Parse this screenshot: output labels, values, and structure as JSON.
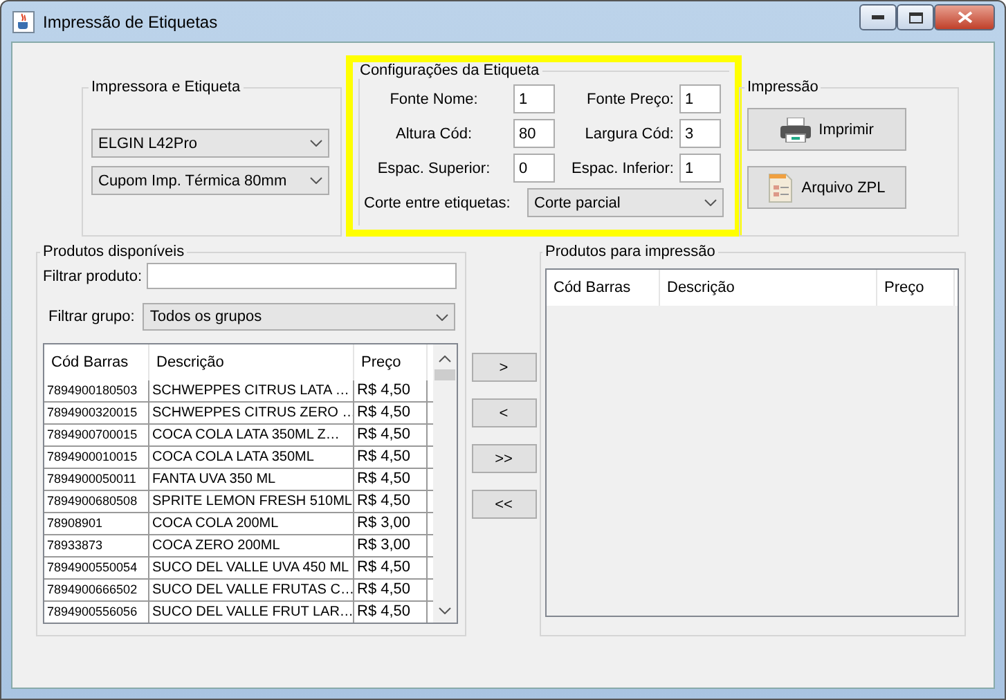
{
  "window": {
    "title": "Impressão de Etiquetas"
  },
  "printer_group": {
    "title": "Impressora e Etiqueta",
    "printer": "ELGIN L42Pro",
    "label_type": "Cupom Imp. Térmica 80mm"
  },
  "config_group": {
    "title": "Configurações da Etiqueta",
    "highlighted": true,
    "fields": [
      {
        "label": "Fonte Nome:",
        "value": "1"
      },
      {
        "label": "Fonte Preço:",
        "value": "1"
      },
      {
        "label": "Altura Cód:",
        "value": "80"
      },
      {
        "label": "Largura Cód:",
        "value": "3"
      },
      {
        "label": "Espac. Superior:",
        "value": "0"
      },
      {
        "label": "Espac. Inferior:",
        "value": "1"
      }
    ],
    "cut_label": "Corte entre etiquetas:",
    "cut_value": "Corte parcial"
  },
  "print_group": {
    "title": "Impressão",
    "buttons": [
      {
        "label": "Imprimir",
        "kind": "printer"
      },
      {
        "label": "Arquivo ZPL",
        "kind": "file"
      }
    ]
  },
  "available": {
    "title": "Produtos disponíveis",
    "filter_label": "Filtrar produto:",
    "group_label": "Filtrar grupo:",
    "group_value": "Todos os grupos",
    "columns": [
      "Cód Barras",
      "Descrição",
      "Preço"
    ],
    "rows": [
      [
        "7894900180503",
        "SCHWEPPES CITRUS LATA …",
        "R$ 4,50"
      ],
      [
        "7894900320015",
        "SCHWEPPES CITRUS ZERO …",
        "R$ 4,50"
      ],
      [
        "7894900700015",
        "COCA COLA LATA 350ML Z…",
        "R$ 4,50"
      ],
      [
        "7894900010015",
        "COCA COLA LATA 350ML",
        "R$ 4,50"
      ],
      [
        "7894900050011",
        "FANTA UVA 350 ML",
        "R$ 4,50"
      ],
      [
        "7894900680508",
        "SPRITE LEMON FRESH 510ML",
        "R$ 4,50"
      ],
      [
        "78908901",
        "COCA COLA 200ML",
        "R$ 3,00"
      ],
      [
        "78933873",
        "COCA ZERO 200ML",
        "R$ 3,00"
      ],
      [
        "7894900550054",
        "SUCO DEL VALLE UVA 450 ML",
        "R$ 4,50"
      ],
      [
        "7894900666502",
        "SUCO DEL VALLE FRUTAS C…",
        "R$ 4,50"
      ],
      [
        "7894900556056",
        "SUCO DEL VALLE FRUT LAR…",
        "R$ 4,50"
      ]
    ]
  },
  "transfer_buttons": [
    ">",
    "<",
    ">>",
    "<<"
  ],
  "selected_products": {
    "title": "Produtos para impressão",
    "columns": [
      "Cód Barras",
      "Descrição",
      "Preço"
    ]
  }
}
